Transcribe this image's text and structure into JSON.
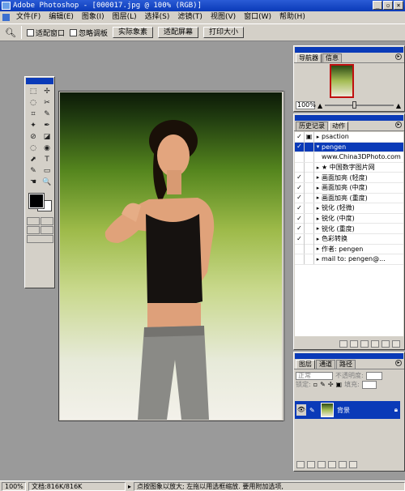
{
  "window": {
    "title": "Adobe Photoshop - [000017.jpg @ 100% (RGB)]",
    "buttons": [
      "_",
      "▫",
      "×"
    ]
  },
  "menu": [
    "文件(F)",
    "编辑(E)",
    "图象(I)",
    "图层(L)",
    "选择(S)",
    "滤镜(T)",
    "视图(V)",
    "窗口(W)",
    "帮助(H)"
  ],
  "options": {
    "tool_icon": "zoom-icon",
    "resize_window": "适配窗口",
    "ignore_palettes": "忽略调板",
    "actual_pixels": "实际象素",
    "fit_screen": "适配屏幕",
    "print_size": "打印大小"
  },
  "toolbox": {
    "tools": [
      "⬚",
      "✢",
      "◌",
      "✂",
      "⌗",
      "✎",
      "✦",
      "✒",
      "⊘",
      "◪",
      "◌",
      "◉",
      "⬈",
      "T",
      "✎",
      "▭",
      "☚",
      "🔍"
    ],
    "colors": {
      "foreground": "#000000",
      "background": "#ffffff"
    }
  },
  "navigator": {
    "tabs": [
      "导航器",
      "信息"
    ],
    "zoom": "100%"
  },
  "actions": {
    "tabs": [
      "历史记录",
      "动作"
    ],
    "items": [
      {
        "check": "✓",
        "dialog": "▣",
        "tri": "▸",
        "label": "psaction",
        "sel": false
      },
      {
        "check": "✓",
        "dialog": "",
        "tri": "▾",
        "label": "pengen",
        "sel": true
      },
      {
        "check": "",
        "dialog": "",
        "tri": "",
        "label": "www.China3DPhoto.com",
        "sel": false
      },
      {
        "check": "",
        "dialog": "",
        "tri": "▸",
        "label": "★ 中国数字图片网",
        "sel": false
      },
      {
        "check": "✓",
        "dialog": "",
        "tri": "▸",
        "label": "画面加亮 (轻度)",
        "sel": false
      },
      {
        "check": "✓",
        "dialog": "",
        "tri": "▸",
        "label": "画面加亮 (中度)",
        "sel": false
      },
      {
        "check": "✓",
        "dialog": "",
        "tri": "▸",
        "label": "画面加亮 (重度)",
        "sel": false
      },
      {
        "check": "✓",
        "dialog": "",
        "tri": "▸",
        "label": "锐化 (轻微)",
        "sel": false
      },
      {
        "check": "✓",
        "dialog": "",
        "tri": "▸",
        "label": "锐化 (中度)",
        "sel": false
      },
      {
        "check": "✓",
        "dialog": "",
        "tri": "▸",
        "label": "锐化 (重度)",
        "sel": false
      },
      {
        "check": "✓",
        "dialog": "",
        "tri": "▸",
        "label": "色彩转换",
        "sel": false
      },
      {
        "check": "",
        "dialog": "",
        "tri": "▸",
        "label": "作者: pengen",
        "sel": false
      },
      {
        "check": "",
        "dialog": "",
        "tri": "▸",
        "label": "mail to: pengen@...",
        "sel": false
      }
    ]
  },
  "layers": {
    "tabs": [
      "图层",
      "通道",
      "路径"
    ],
    "blend_mode": "正常",
    "opacity_label": "不透明度:",
    "lock_label": "锁定:",
    "fill_label": "填充:",
    "layer_name": "背景"
  },
  "status": {
    "zoom": "100%",
    "doc_size": "文档:816K/816K",
    "hint": "点按图象以放大; 左拖以用选框缩放. 要用附加选项,"
  }
}
